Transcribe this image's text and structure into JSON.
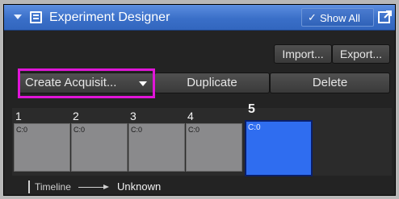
{
  "panel": {
    "title": "Experiment Designer",
    "show_all_label": "Show All",
    "colors": {
      "title_bar": "#3a6fc8",
      "selected_block": "#2f6df0",
      "highlight": "#e015d8",
      "panel_bg": "#232323"
    }
  },
  "buttons": {
    "import": "Import...",
    "export": "Export...",
    "create": "Create Acquisit...",
    "duplicate": "Duplicate",
    "delete": "Delete"
  },
  "blocks": [
    {
      "number": "1",
      "channel": "C:0",
      "selected": false
    },
    {
      "number": "2",
      "channel": "C:0",
      "selected": false
    },
    {
      "number": "3",
      "channel": "C:0",
      "selected": false
    },
    {
      "number": "4",
      "channel": "C:0",
      "selected": false
    },
    {
      "number": "5",
      "channel": "C:0",
      "selected": true
    }
  ],
  "timeline": {
    "label": "Timeline",
    "value": "Unknown"
  },
  "icons": [
    "collapse-chevron-icon",
    "experiment-designer-icon",
    "checkmark-icon",
    "popout-icon",
    "dropdown-caret-icon",
    "arrow-right-icon"
  ]
}
